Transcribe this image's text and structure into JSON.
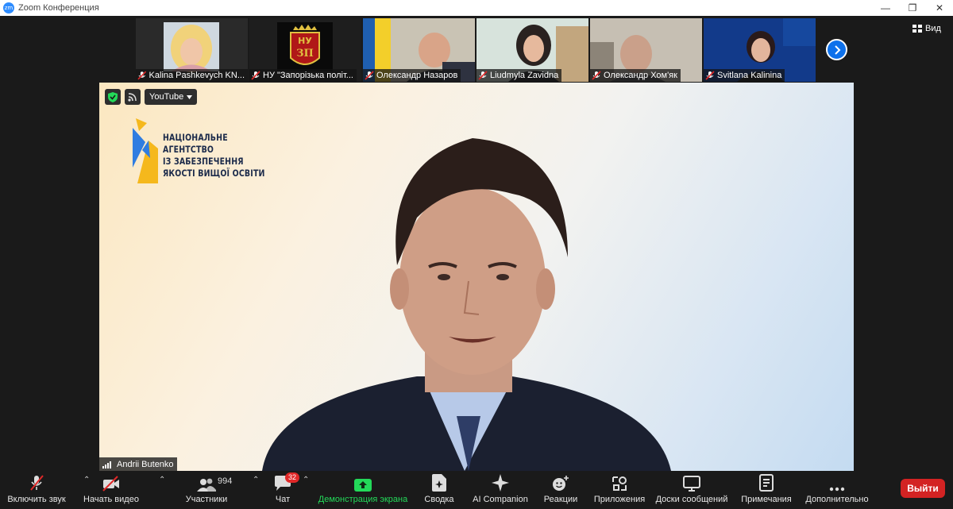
{
  "window": {
    "logo_text": "zm",
    "title": "Zoom Конференция",
    "minimize": "—",
    "restore": "❐",
    "close": "✕"
  },
  "gallery": {
    "participants": [
      {
        "name": "Kalina Pashkevych KN..."
      },
      {
        "name": "НУ \"Запорізька політ..."
      },
      {
        "name": "Олександр Назаров"
      },
      {
        "name": "Liudmyla Zavidna"
      },
      {
        "name": "Олександр Хом'як"
      },
      {
        "name": "Svitlana Kalinina"
      }
    ],
    "tile2_logo_top": "НУ",
    "tile2_logo_bottom": "ЗП",
    "view_label": "Вид"
  },
  "main": {
    "stream_label": "YouTube",
    "logo_lines": [
      "НАЦІОНАЛЬНЕ",
      "АГЕНТСТВО",
      "ІЗ ЗАБЕЗПЕЧЕННЯ",
      "ЯКОСТІ ВИЩОЇ ОСВІТИ"
    ],
    "speaker_name": "Andrii Butenko"
  },
  "toolbar": {
    "audio_label": "Включить звук",
    "video_label": "Начать видео",
    "participants_label": "Участники",
    "participants_count": "994",
    "chat_label": "Чат",
    "chat_badge": "32",
    "share_label": "Демонстрация экрана",
    "summary_label": "Сводка",
    "ai_label": "AI Companion",
    "reactions_label": "Реакции",
    "apps_label": "Приложения",
    "whiteboards_label": "Доски сообщений",
    "notes_label": "Примечания",
    "more_label": "Дополнительно",
    "exit_label": "Выйти"
  },
  "colors": {
    "accent_blue": "#0e71eb",
    "share_green": "#23d959",
    "exit_red": "#d32323",
    "mute_red": "#e02828"
  }
}
